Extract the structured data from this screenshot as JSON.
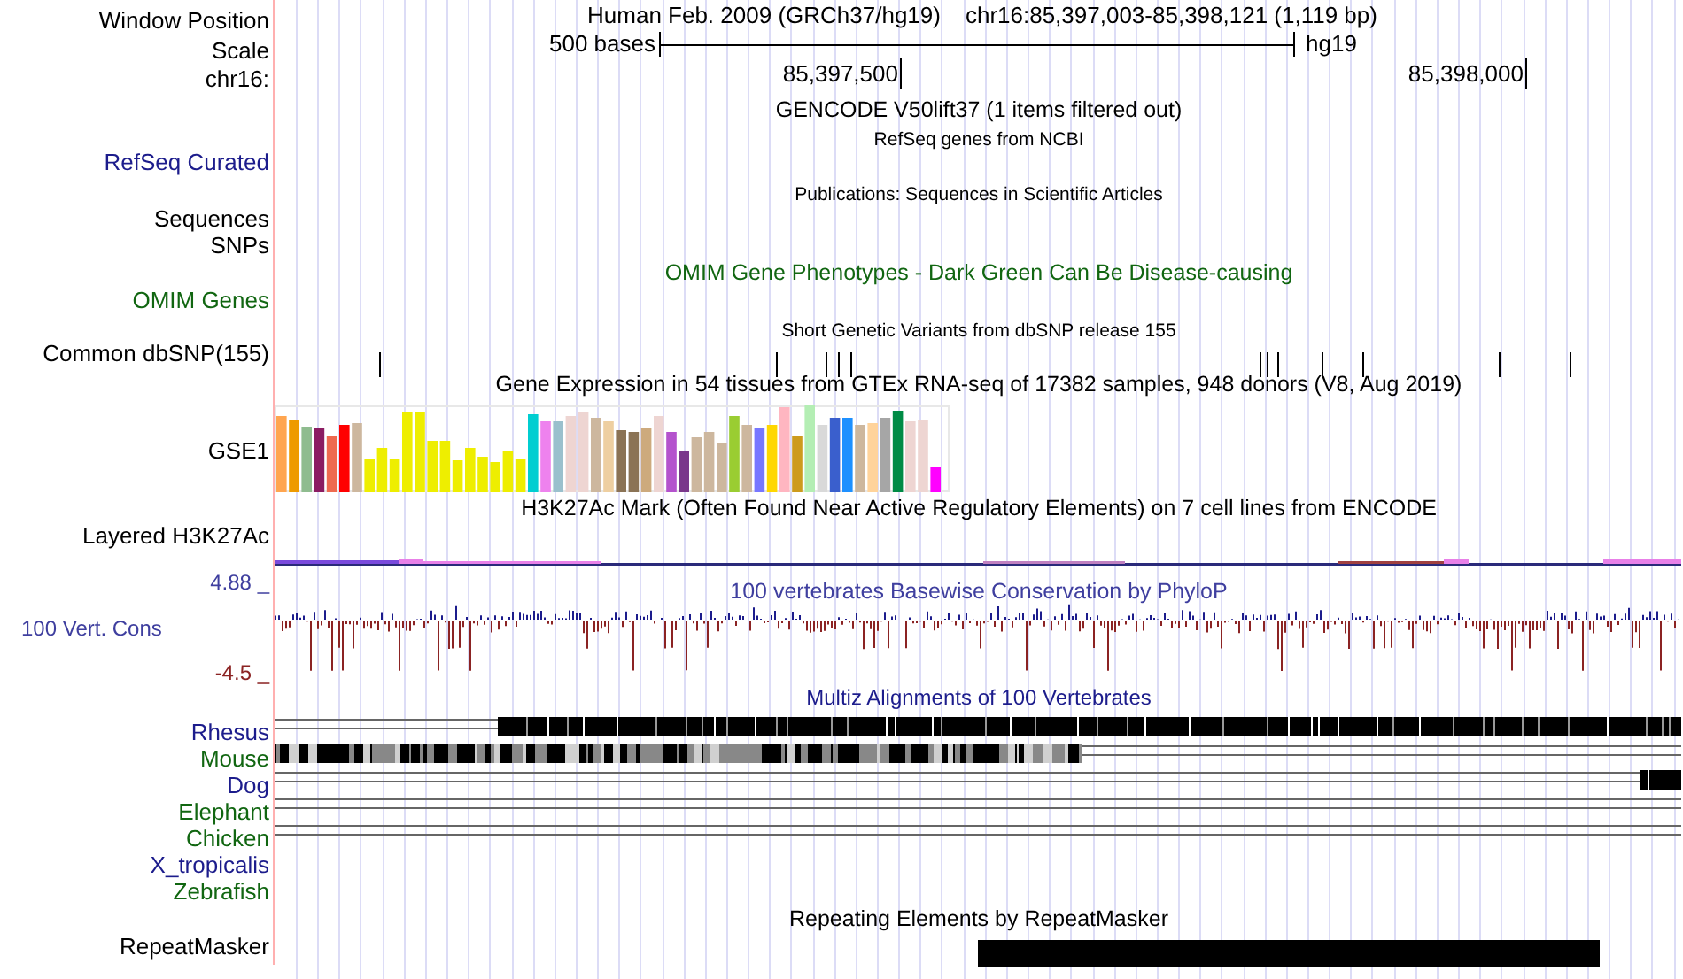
{
  "header": {
    "window_position_label": "Window Position",
    "assembly": "Human Feb. 2009 (GRCh37/hg19)",
    "position": "chr16:85,397,003-85,398,121 (1,119 bp)",
    "scale_label": "Scale",
    "scale_text": "500 bases",
    "scale_db": "hg19",
    "chrom_label": "chr16:",
    "ticks": [
      "85,397,500",
      "85,398,000"
    ]
  },
  "tracks": [
    {
      "kind": "gencode",
      "title": "GENCODE V50lift37 (1 items filtered out)"
    },
    {
      "kind": "refseq",
      "label": "RefSeq Curated",
      "color": "#1c1c8c",
      "title": "RefSeq genes from NCBI"
    },
    {
      "kind": "publications",
      "title": "Publications: Sequences in Scientific Articles"
    },
    {
      "kind": "simple",
      "label": "Sequences",
      "color": "#000000"
    },
    {
      "kind": "simple",
      "label": "SNPs",
      "color": "#000000"
    },
    {
      "kind": "omim",
      "label": "OMIM Genes",
      "color": "#116611",
      "title": "OMIM Gene Phenotypes - Dark Green Can Be Disease-causing"
    },
    {
      "kind": "dbsnp",
      "label": "Common dbSNP(155)",
      "color": "#000000",
      "title": "Short Genetic Variants from dbSNP release 155"
    },
    {
      "kind": "gtex",
      "label": "GSE1",
      "color": "#000000",
      "title": "Gene Expression in 54 tissues from GTEx RNA-seq of 17382 samples, 948 donors (V8, Aug 2019)"
    },
    {
      "kind": "h3k27ac",
      "label": "Layered H3K27Ac",
      "color": "#000000",
      "title": "H3K27Ac Mark (Often Found Near Active Regulatory Elements) on 7 cell lines from ENCODE"
    },
    {
      "kind": "phylop",
      "label": "100 Vert. Cons",
      "color": "#3f3f9f",
      "title": "100 vertebrates Basewise Conservation by PhyloP",
      "max_label": "4.88 _",
      "min_label": "-4.5 _"
    },
    {
      "kind": "multiz",
      "title": "Multiz Alignments of 100 Vertebrates",
      "color": "#1c1c8c",
      "species": [
        {
          "name": "Rhesus",
          "color": "#1c1c8c",
          "kind": "dense"
        },
        {
          "name": "Mouse",
          "color": "#116611",
          "kind": "partial"
        },
        {
          "name": "Dog",
          "color": "#1c1c8c",
          "kind": "tail"
        },
        {
          "name": "Elephant",
          "color": "#116611",
          "kind": "lines"
        },
        {
          "name": "Chicken",
          "color": "#116611",
          "kind": "lines"
        },
        {
          "name": "X_tropicalis",
          "color": "#1c1c8c",
          "kind": "none"
        },
        {
          "name": "Zebrafish",
          "color": "#116611",
          "kind": "none"
        }
      ]
    },
    {
      "kind": "repeatmasker",
      "label": "RepeatMasker",
      "color": "#000000",
      "title": "Repeating Elements by RepeatMasker"
    }
  ]
}
